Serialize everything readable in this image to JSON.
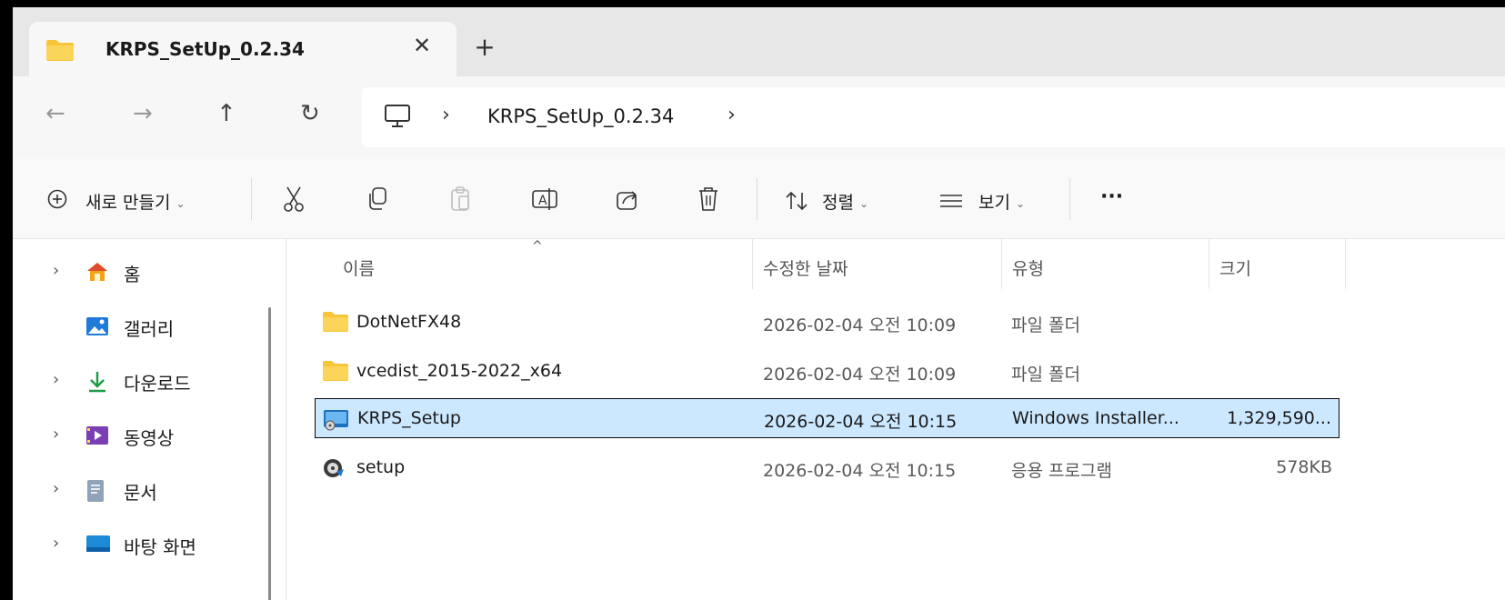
{
  "tab": {
    "title": "KRPS_SetUp_0.2.34",
    "close_glyph": "✕",
    "new_tab_glyph": "+"
  },
  "nav": {
    "back_glyph": "←",
    "forward_glyph": "→",
    "up_glyph": "↑",
    "refresh_glyph": "↻",
    "chevron": "›",
    "breadcrumb": "KRPS_SetUp_0.2.34"
  },
  "commandbar": {
    "new_label": "새로 만들기",
    "sort_label": "정렬",
    "view_label": "보기",
    "more_label": "···",
    "caret": "⌄"
  },
  "sidebar": {
    "items": [
      {
        "label": "홈",
        "icon": "home-icon",
        "has_chevron": true
      },
      {
        "label": "갤러리",
        "icon": "gallery-icon",
        "has_chevron": false
      },
      {
        "label": "다운로드",
        "icon": "download-icon",
        "has_chevron": true
      },
      {
        "label": "동영상",
        "icon": "videos-icon",
        "has_chevron": true
      },
      {
        "label": "문서",
        "icon": "documents-icon",
        "has_chevron": true
      },
      {
        "label": "바탕 화면",
        "icon": "desktop-icon",
        "has_chevron": true
      }
    ],
    "chevron": "›"
  },
  "columns": {
    "name": "이름",
    "date": "수정한 날짜",
    "type": "유형",
    "size": "크기",
    "sort_glyph": "^"
  },
  "files": [
    {
      "name": "DotNetFX48",
      "date": "2026-02-04 오전 10:09",
      "type": "파일 폴더",
      "size": "",
      "icon": "folder-icon",
      "selected": false
    },
    {
      "name": "vcedist_2015-2022_x64",
      "date": "2026-02-04 오전 10:09",
      "type": "파일 폴더",
      "size": "",
      "icon": "folder-icon",
      "selected": false
    },
    {
      "name": "KRPS_Setup",
      "date": "2026-02-04 오전 10:15",
      "type": "Windows Installer...",
      "size": "1,329,590...",
      "icon": "msi-installer-icon",
      "selected": true
    },
    {
      "name": "setup",
      "date": "2026-02-04 오전 10:15",
      "type": "응용 프로그램",
      "size": "578KB",
      "icon": "setup-exe-icon",
      "selected": false
    }
  ],
  "colors": {
    "selection_bg": "#cce8ff",
    "folder_yellow": "#f8c53a",
    "accent_blue": "#0067c0"
  }
}
